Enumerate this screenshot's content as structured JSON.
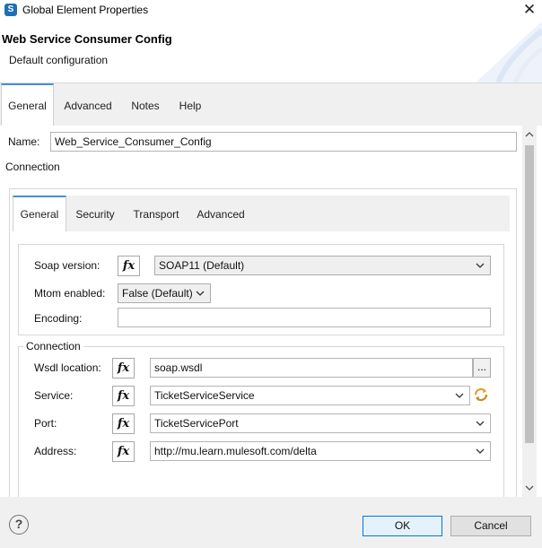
{
  "window": {
    "title": "Global Element Properties",
    "close_glyph": "✕",
    "app_icon": "studio-icon"
  },
  "banner": {
    "title": "Web Service Consumer Config",
    "subtitle": "Default configuration"
  },
  "top_tabs": [
    {
      "label": "General",
      "active": true
    },
    {
      "label": "Advanced",
      "active": false
    },
    {
      "label": "Notes",
      "active": false
    },
    {
      "label": "Help",
      "active": false
    }
  ],
  "general": {
    "name_label": "Name:",
    "name_value": "Web_Service_Consumer_Config",
    "connection_label": "Connection"
  },
  "inner_tabs": [
    {
      "label": "General",
      "active": true
    },
    {
      "label": "Security",
      "active": false
    },
    {
      "label": "Transport",
      "active": false
    },
    {
      "label": "Advanced",
      "active": false
    }
  ],
  "soap": {
    "soap_version_label": "Soap version:",
    "soap_version_value": "SOAP11 (Default)",
    "mtom_label": "Mtom enabled:",
    "mtom_value": "False (Default)",
    "encoding_label": "Encoding:",
    "encoding_value": ""
  },
  "connection": {
    "group_title": "Connection",
    "wsdl_label": "Wsdl location:",
    "wsdl_value": "soap.wsdl",
    "browse_label": "...",
    "service_label": "Service:",
    "service_value": "TicketServiceService",
    "port_label": "Port:",
    "port_value": "TicketServicePort",
    "address_label": "Address:",
    "address_value": "http://mu.learn.mulesoft.com/delta"
  },
  "fx_label": "fx",
  "footer": {
    "help_glyph": "?",
    "ok_label": "OK",
    "cancel_label": "Cancel"
  },
  "colors": {
    "accent": "#4c8fcf",
    "default_button_border": "#0078d7",
    "refresh_icon": "#e0a020"
  }
}
